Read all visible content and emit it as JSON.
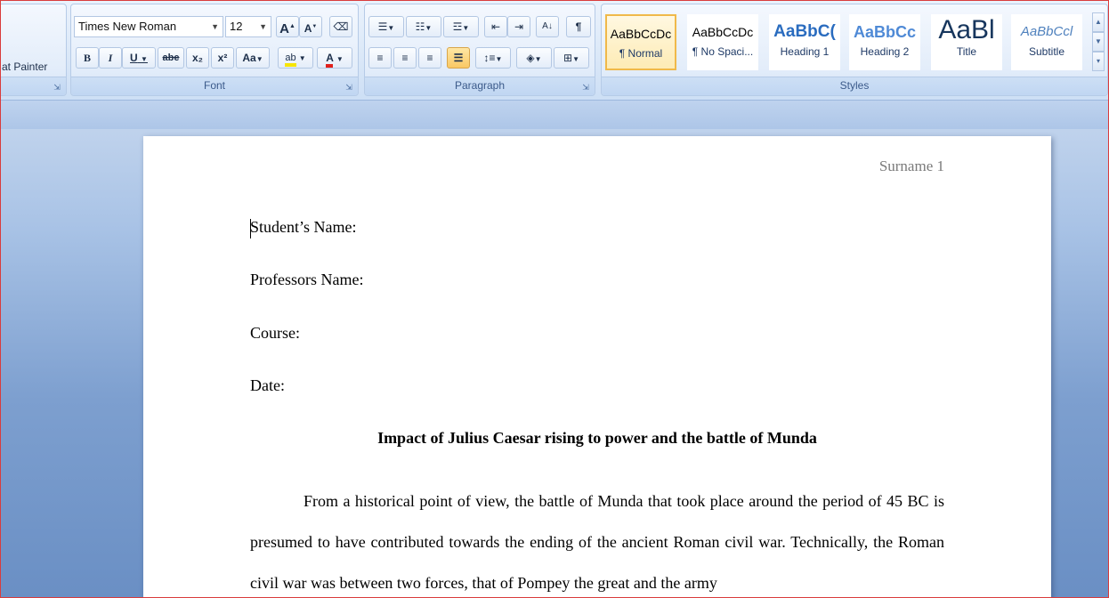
{
  "clipboard": {
    "format_painter": "at Painter",
    "group_launcher": "⌐"
  },
  "font": {
    "family": "Times New Roman",
    "size": "12",
    "grow_label": "A",
    "shrink_label": "A",
    "bold": "B",
    "italic": "I",
    "underline": "U",
    "strike": "abe",
    "subscript": "x₂",
    "superscript": "x²",
    "change_case": "Aa",
    "highlight": "ab",
    "font_color": "A",
    "group_label": "Font"
  },
  "paragraph": {
    "group_label": "Paragraph"
  },
  "styles": {
    "group_label": "Styles",
    "tiles": [
      {
        "sample": "AaBbCcDc",
        "name": "¶ Normal"
      },
      {
        "sample": "AaBbCcDc",
        "name": "¶ No Spaci..."
      },
      {
        "sample": "AaBbC(",
        "name": "Heading 1"
      },
      {
        "sample": "AaBbCc",
        "name": "Heading 2"
      },
      {
        "sample": "AaBl",
        "name": "Title"
      },
      {
        "sample": "AaBbCcl",
        "name": "Subtitle"
      }
    ]
  },
  "document": {
    "header": "Surname 1",
    "lines": [
      "Student’s Name:",
      "Professors Name:",
      "Course:",
      "Date:"
    ],
    "title": "Impact of Julius Caesar rising to power and the battle of Munda",
    "paragraph": "From a historical point of view, the battle of Munda that took place around the period of 45 BC is presumed to have contributed towards the ending of the ancient Roman civil war. Technically, the Roman civil war was between two forces, that of Pompey the great and the army"
  },
  "colors": {
    "accent_highlight": "#f7d24a",
    "font_color_bar": "#e0201b",
    "page": "#ffffff"
  }
}
